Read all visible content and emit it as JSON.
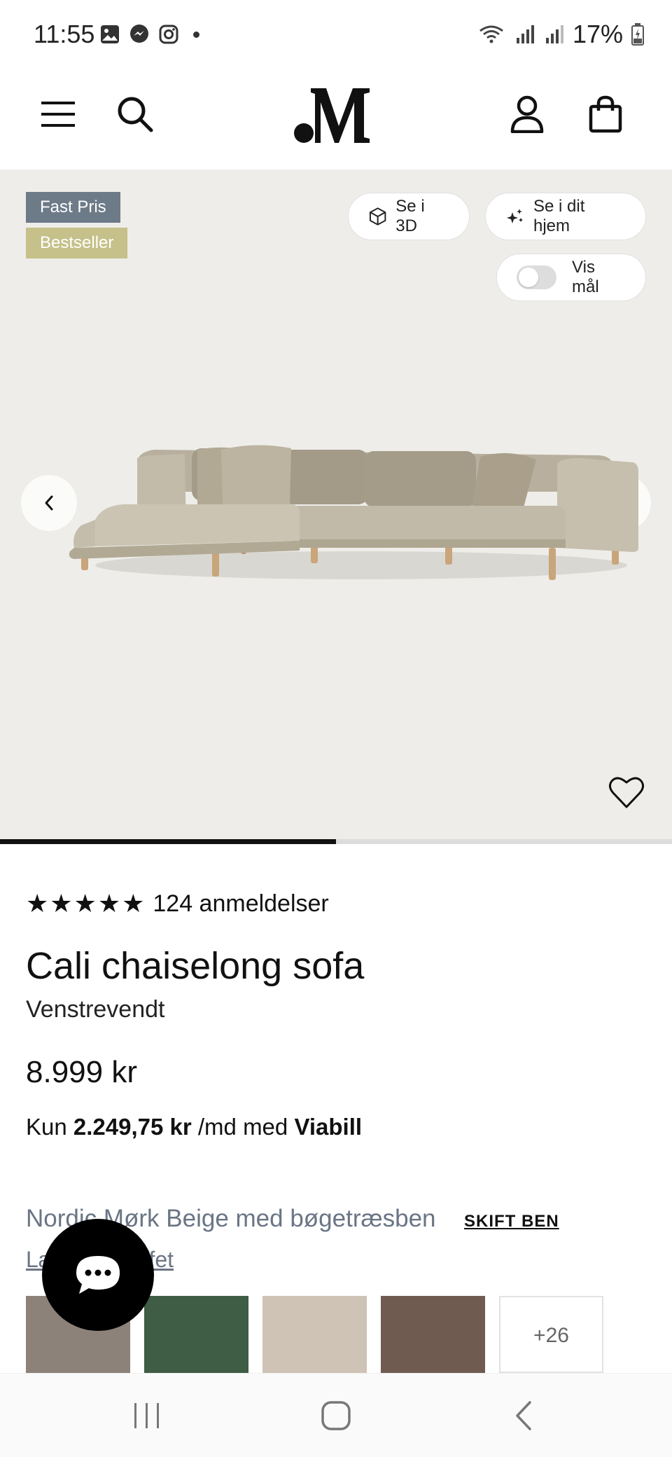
{
  "status_bar": {
    "time": "11:55",
    "battery": "17%",
    "icons_left": [
      "gallery-icon",
      "messenger-icon",
      "instagram-icon",
      "dot-icon"
    ],
    "icons_right": [
      "wifi-icon",
      "signal-icon",
      "signal-icon",
      "battery-icon"
    ]
  },
  "header": {
    "menu_icon": "hamburger-menu-icon",
    "search_icon": "search-icon",
    "logo_text": ".M",
    "account_icon": "user-icon",
    "cart_icon": "shopping-bag-icon"
  },
  "gallery": {
    "badges": {
      "fast_pris": "Fast Pris",
      "bestseller": "Bestseller"
    },
    "buttons": {
      "see_3d": "Se i 3D",
      "see_home": "Se i dit hjem",
      "show_dimensions": "Vis mål"
    },
    "show_dimensions_on": false,
    "progress": 0.5,
    "colors": {
      "background": "#eeedea",
      "badge_fast": "#6d7a88",
      "badge_best": "#c6c08a"
    }
  },
  "product": {
    "stars": "★★★★★",
    "rating": 5,
    "reviews": "124 anmeldelser",
    "title": "Cali chaiselong sofa",
    "variant": "Venstrevendt",
    "price": "8.999 kr",
    "finance_prefix": "Kun",
    "finance_amount": "2.249,75 kr",
    "finance_mid": "/md med",
    "finance_provider": "Viabill",
    "color_name": "Nordic Mørk Beige med bøgetræsben",
    "change_legs": "SKIFT BEN",
    "link2": "Læs om stoffet"
  },
  "swatches": {
    "colors": [
      "#8c8279",
      "#3f5c45",
      "#cfc3b6",
      "#6f5b50"
    ],
    "more": "+26"
  },
  "chat": {
    "icon": "chat-bubble-icon"
  },
  "nav": {
    "recents": "recent-apps-icon",
    "home": "home-icon",
    "back": "back-icon"
  }
}
